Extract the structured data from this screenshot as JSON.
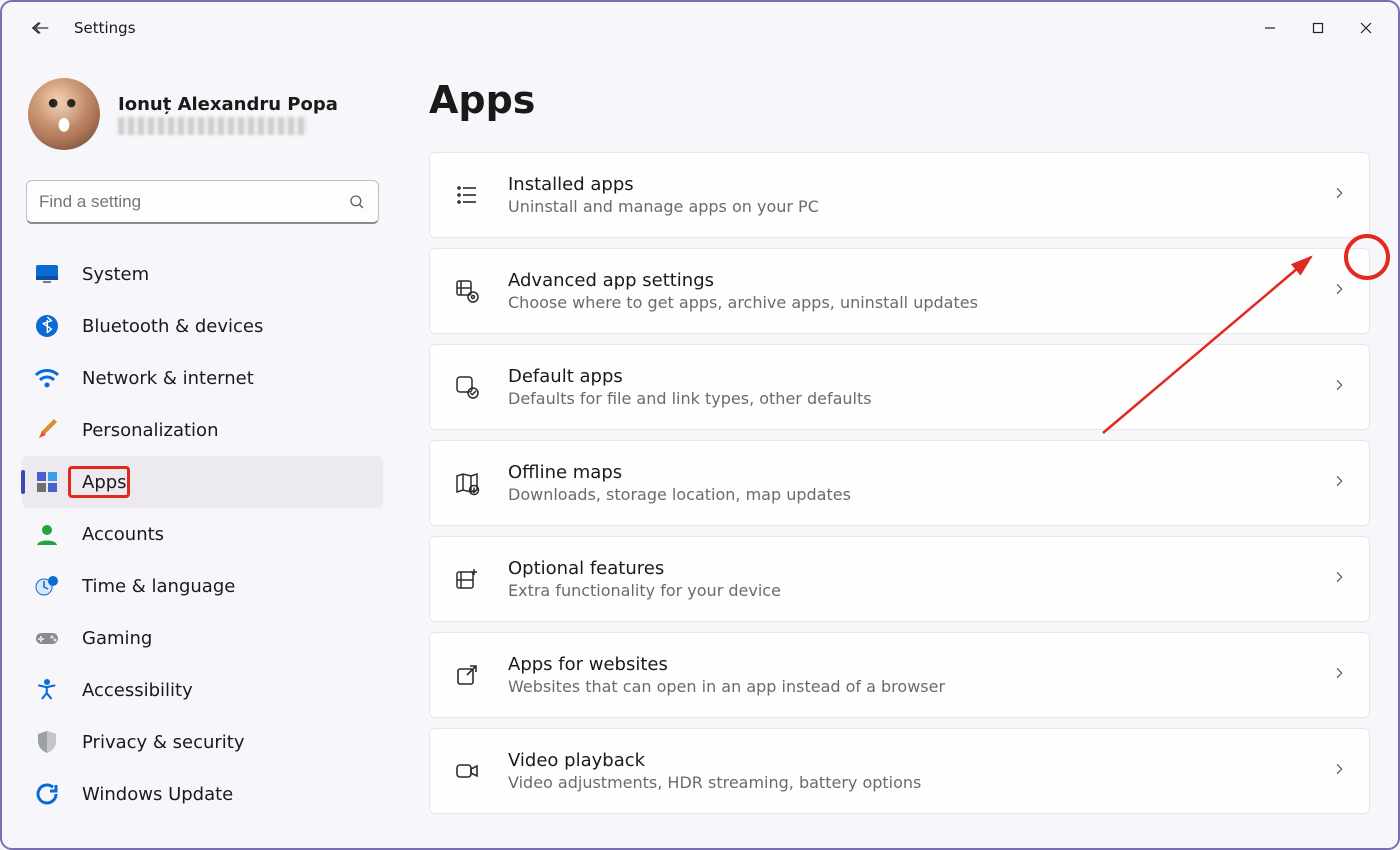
{
  "window": {
    "title": "Settings"
  },
  "profile": {
    "name": "Ionuț Alexandru Popa"
  },
  "search": {
    "placeholder": "Find a setting"
  },
  "sidebar": {
    "items": [
      {
        "id": "system",
        "label": "System"
      },
      {
        "id": "bluetooth",
        "label": "Bluetooth & devices"
      },
      {
        "id": "network",
        "label": "Network & internet"
      },
      {
        "id": "personalization",
        "label": "Personalization"
      },
      {
        "id": "apps",
        "label": "Apps",
        "active": true,
        "highlight": true
      },
      {
        "id": "accounts",
        "label": "Accounts"
      },
      {
        "id": "time",
        "label": "Time & language"
      },
      {
        "id": "gaming",
        "label": "Gaming"
      },
      {
        "id": "accessibility",
        "label": "Accessibility"
      },
      {
        "id": "privacy",
        "label": "Privacy & security"
      },
      {
        "id": "update",
        "label": "Windows Update"
      }
    ]
  },
  "page": {
    "heading": "Apps"
  },
  "cards": [
    {
      "id": "installed",
      "title": "Installed apps",
      "desc": "Uninstall and manage apps on your PC",
      "highlight": true
    },
    {
      "id": "advanced",
      "title": "Advanced app settings",
      "desc": "Choose where to get apps, archive apps, uninstall updates"
    },
    {
      "id": "default",
      "title": "Default apps",
      "desc": "Defaults for file and link types, other defaults"
    },
    {
      "id": "maps",
      "title": "Offline maps",
      "desc": "Downloads, storage location, map updates"
    },
    {
      "id": "optional",
      "title": "Optional features",
      "desc": "Extra functionality for your device"
    },
    {
      "id": "websites",
      "title": "Apps for websites",
      "desc": "Websites that can open in an app instead of a browser"
    },
    {
      "id": "video",
      "title": "Video playback",
      "desc": "Video adjustments, HDR streaming, battery options"
    }
  ],
  "icons": {
    "sidebar": {
      "system": "monitor-icon",
      "bluetooth": "bluetooth-icon",
      "network": "wifi-icon",
      "personalization": "paintbrush-icon",
      "apps": "apps-grid-icon",
      "accounts": "person-icon",
      "time": "clock-globe-icon",
      "gaming": "gamepad-icon",
      "accessibility": "accessibility-icon",
      "privacy": "shield-icon",
      "update": "sync-icon"
    },
    "cards": {
      "installed": "list-icon",
      "advanced": "app-gear-icon",
      "default": "app-check-icon",
      "maps": "map-download-icon",
      "optional": "app-plus-icon",
      "websites": "open-external-icon",
      "video": "video-camera-icon"
    }
  },
  "colors": {
    "accent": "#3a4ab9",
    "annotation": "#e2281f",
    "blue": "#0b6bd5",
    "green": "#22a33b"
  }
}
